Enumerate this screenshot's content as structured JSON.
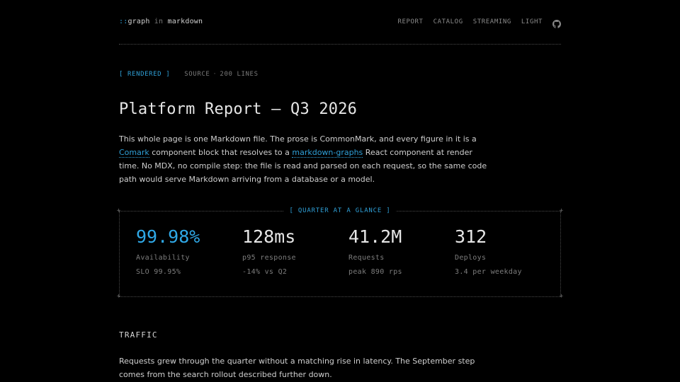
{
  "brand": {
    "prefix": "::",
    "name": "graph",
    "joiner": "in",
    "suffix": "markdown"
  },
  "nav": {
    "items": [
      "REPORT",
      "CATALOG",
      "STREAMING",
      "LIGHT"
    ],
    "github_icon": "github-icon"
  },
  "tabs": {
    "active": "[ RENDERED ]",
    "source": "SOURCE",
    "separator": "·",
    "lines": "200 LINES"
  },
  "title": "Platform Report — Q3 2026",
  "intro": {
    "t1": "This whole page is one Markdown file. The prose is CommonMark, and every figure in it is a ",
    "link1": "Comark",
    "t2": " component block that resolves to a ",
    "link2": "markdown-graphs",
    "t3": " React component at render time. No MDX, no compile step: the file is read and parsed on each request, so the same code path would serve Markdown arriving from a database or a model."
  },
  "glance": {
    "label": "[ QUARTER AT A GLANCE ]",
    "stats": [
      {
        "value": "99.98%",
        "label": "Availability",
        "sub": "SLO 99.95%"
      },
      {
        "value": "128ms",
        "label": "p95 response",
        "sub": "-14% vs Q2"
      },
      {
        "value": "41.2M",
        "label": "Requests",
        "sub": "peak 890 rps"
      },
      {
        "value": "312",
        "label": "Deploys",
        "sub": "3.4 per weekday"
      }
    ]
  },
  "traffic": {
    "heading": "TRAFFIC",
    "text": "Requests grew through the quarter without a matching rise in latency. The September step comes from the search rollout described further down."
  },
  "colors": {
    "background": "#000000",
    "accent": "#2fa8e6",
    "text": "#d6d6d6",
    "muted": "#7d7d7d"
  }
}
